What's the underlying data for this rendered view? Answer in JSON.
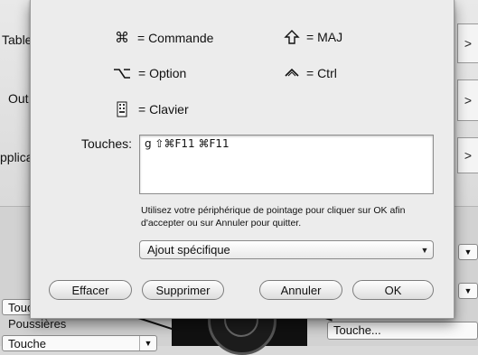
{
  "background": {
    "rows": [
      "Table",
      "Out",
      "pplica"
    ],
    "right_button_glyph": ">",
    "combo_touche_1": "Touche",
    "combo_touche_2": "Touche",
    "label_poussieres": "Poussières",
    "combo_touche_right": "Touche...",
    "combo_arrow": "▼"
  },
  "sheet": {
    "modifiers": {
      "command": "= Commande",
      "shift": "= MAJ",
      "option": "= Option",
      "ctrl": "= Ctrl",
      "keyboard": "= Clavier"
    },
    "keys_label": "Touches:",
    "keys_value": "g ⇧⌘F11 ⌘F11",
    "hint": "Utilisez votre périphérique de pointage pour cliquer sur OK afin d'accepter ou sur Annuler pour quitter.",
    "popup": {
      "selected": "Ajout spécifique",
      "arrow": "▼"
    },
    "buttons": {
      "clear": "Effacer",
      "delete": "Supprimer",
      "cancel": "Annuler",
      "ok": "OK"
    },
    "icons": {
      "command": "command-icon",
      "shift": "shift-icon",
      "option": "option-icon",
      "ctrl": "control-icon",
      "keyboard": "keyboard-icon"
    }
  }
}
